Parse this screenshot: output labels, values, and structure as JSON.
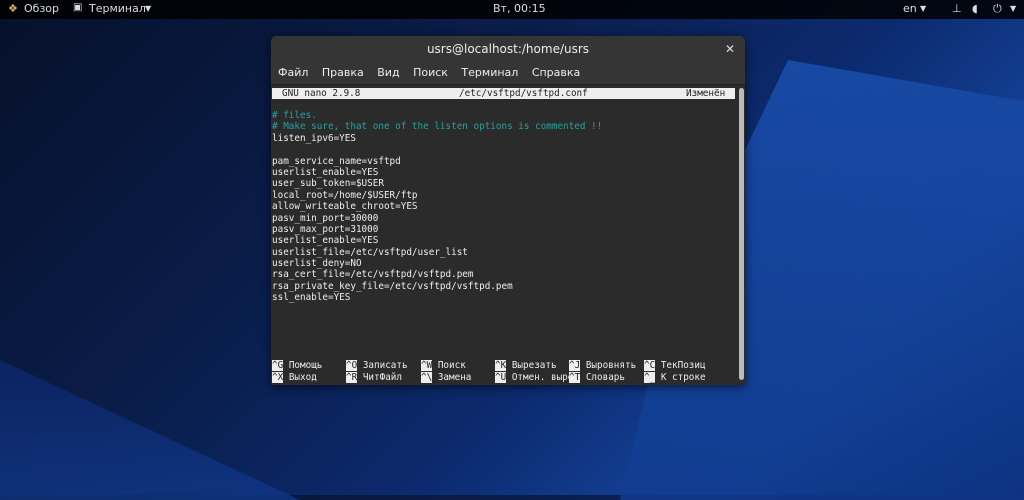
{
  "topbar": {
    "overview": "Обзор",
    "app": "Терминал",
    "clock": "Вт, 00:15",
    "lang": "en"
  },
  "window": {
    "title": "usrs@localhost:/home/usrs",
    "menu": [
      "Файл",
      "Правка",
      "Вид",
      "Поиск",
      "Терминал",
      "Справка"
    ]
  },
  "nano": {
    "version": "GNU nano 2.9.8",
    "file": "/etc/vsftpd/vsftpd.conf",
    "status": "Изменён",
    "lines": [
      {
        "t": "# files.",
        "c": true
      },
      {
        "t": "# Make sure, that one of the listen options is commented !!",
        "c": true
      },
      {
        "t": "listen_ipv6=YES"
      },
      {
        "t": ""
      },
      {
        "t": "pam_service_name=vsftpd"
      },
      {
        "t": "userlist_enable=YES"
      },
      {
        "t": "user_sub_token=$USER"
      },
      {
        "t": "local_root=/home/$USER/ftp"
      },
      {
        "t": "allow_writeable_chroot=YES"
      },
      {
        "t": "pasv_min_port=30000"
      },
      {
        "t": "pasv_max_port=31000"
      },
      {
        "t": "userlist_enable=YES"
      },
      {
        "t": "userlist_file=/etc/vsftpd/user_list"
      },
      {
        "t": "userlist_deny=NO"
      },
      {
        "t": "rsa_cert_file=/etc/vsftpd/vsftpd.pem"
      },
      {
        "t": "rsa_private_key_file=/etc/vsftpd/vsftpd.pem"
      },
      {
        "t": "ssl_enable=YES"
      }
    ],
    "shortcuts": [
      [
        {
          "k": "^G",
          "l": "Помощь"
        },
        {
          "k": "^O",
          "l": "Записать"
        },
        {
          "k": "^W",
          "l": "Поиск"
        },
        {
          "k": "^K",
          "l": "Вырезать"
        },
        {
          "k": "^J",
          "l": "Выровнять"
        },
        {
          "k": "^C",
          "l": "ТекПозиц"
        }
      ],
      [
        {
          "k": "^X",
          "l": "Выход"
        },
        {
          "k": "^R",
          "l": "ЧитФайл"
        },
        {
          "k": "^\\",
          "l": "Замена"
        },
        {
          "k": "^U",
          "l": "Отмен. выре"
        },
        {
          "k": "^T",
          "l": "Словарь"
        },
        {
          "k": "^_",
          "l": "К строке"
        }
      ]
    ]
  }
}
